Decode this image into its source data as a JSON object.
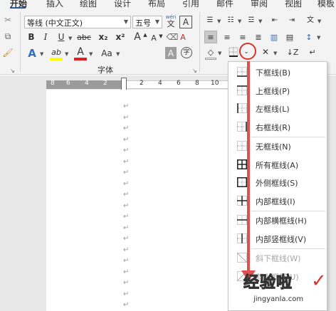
{
  "tabs": [
    {
      "label": "开始",
      "active": true
    },
    {
      "label": "插入"
    },
    {
      "label": "绘图"
    },
    {
      "label": "设计"
    },
    {
      "label": "布局"
    },
    {
      "label": "引用"
    },
    {
      "label": "邮件"
    },
    {
      "label": "审阅"
    },
    {
      "label": "视图"
    },
    {
      "label": "模板"
    }
  ],
  "ribbon": {
    "font_name": "等线 (中文正文)",
    "font_size": "五号",
    "phonetic_top": "wén",
    "phonetic_char": "文",
    "char_border": "A",
    "bold": "B",
    "italic": "I",
    "underline": "U",
    "strike": "abc",
    "subscript": "x₂",
    "superscript": "x²",
    "grow_font": "A",
    "shrink_font": "A",
    "change_case": "Aa",
    "clear_format": "A",
    "text_effect": "A",
    "highlight": "ab",
    "font_color": "A",
    "char_shade": "A",
    "enclose_char": "字",
    "font_group_label": "字体"
  },
  "ruler": {
    "left_numbers": [
      "8",
      "6",
      "4",
      "2"
    ],
    "right_numbers": [
      "2",
      "4",
      "6",
      "8",
      "10"
    ]
  },
  "paragraph_mark": "↵",
  "border_menu": {
    "items": [
      {
        "label": "下框线(B)",
        "icon": "bottom-border-icon",
        "disabled": false
      },
      {
        "label": "上框线(P)",
        "icon": "top-border-icon",
        "disabled": false
      },
      {
        "label": "左框线(L)",
        "icon": "left-border-icon",
        "disabled": false
      },
      {
        "label": "右框线(R)",
        "icon": "right-border-icon",
        "disabled": false
      },
      {
        "label": "无框线(N)",
        "icon": "no-border-icon",
        "disabled": false
      },
      {
        "label": "所有框线(A)",
        "icon": "all-borders-icon",
        "disabled": false
      },
      {
        "label": "外侧框线(S)",
        "icon": "outside-borders-icon",
        "disabled": false
      },
      {
        "label": "内部框线(I)",
        "icon": "inside-borders-icon",
        "disabled": false
      },
      {
        "label": "内部横框线(H)",
        "icon": "inside-horizontal-border-icon",
        "disabled": false
      },
      {
        "label": "内部竖框线(V)",
        "icon": "inside-vertical-border-icon",
        "disabled": false
      },
      {
        "label": "斜下框线(W)",
        "icon": "diagonal-down-border-icon",
        "disabled": true
      },
      {
        "label": "斜上框线(U)",
        "icon": "diagonal-up-border-icon",
        "disabled": true
      }
    ]
  },
  "watermark": {
    "text": "经验啦",
    "url": "jingyanla.com",
    "check": "✓"
  },
  "colors": {
    "accent": "#2b579a",
    "highlight_yellow": "#ffff00",
    "font_red": "#e02020",
    "annotation_red": "#d9342b",
    "text_effect_blue": "#2f6fbd"
  }
}
